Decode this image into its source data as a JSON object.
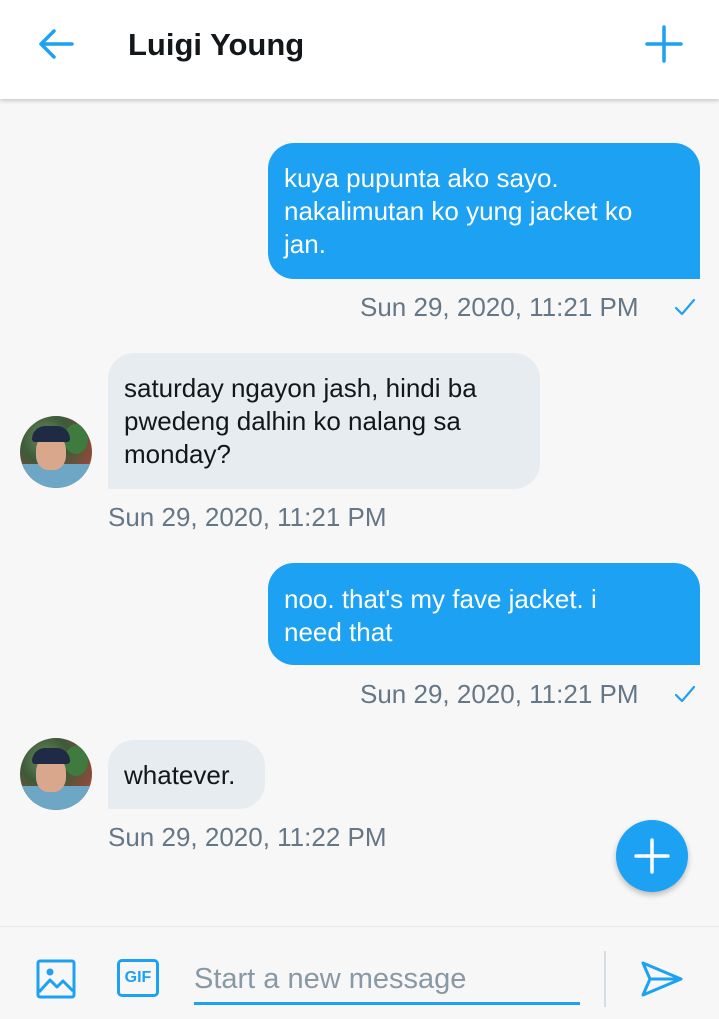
{
  "header": {
    "title": "Luigi Young",
    "back_icon": "arrow-left-icon",
    "add_icon": "plus-icon"
  },
  "messages": [
    {
      "direction": "outgoing",
      "lines": [
        "kuya pupunta ako sayo.",
        "nakalimutan ko yung jacket ko",
        "jan."
      ],
      "timestamp": "Sun 29, 2020, 11:21 PM",
      "read_icon": "checkmark-icon"
    },
    {
      "direction": "incoming",
      "lines": [
        "saturday ngayon jash, hindi ba",
        "pwedeng dalhin ko nalang sa",
        "monday?"
      ],
      "timestamp": "Sun 29, 2020, 11:21 PM"
    },
    {
      "direction": "outgoing",
      "lines": [
        "noo. that's my fave jacket. i",
        "need that"
      ],
      "timestamp": "Sun 29, 2020, 11:21 PM",
      "read_icon": "checkmark-icon"
    },
    {
      "direction": "incoming",
      "lines": [
        "whatever."
      ],
      "timestamp": "Sun 29, 2020, 11:22 PM"
    }
  ],
  "composer": {
    "placeholder": "Start a new message",
    "gif_label": "GIF",
    "image_icon": "image-icon",
    "send_icon": "send-icon"
  },
  "fab_icon": "plus-icon",
  "colors": {
    "accent": "#1da1f2",
    "incoming_bubble": "#e6ecf0",
    "timestamp": "#657786"
  }
}
